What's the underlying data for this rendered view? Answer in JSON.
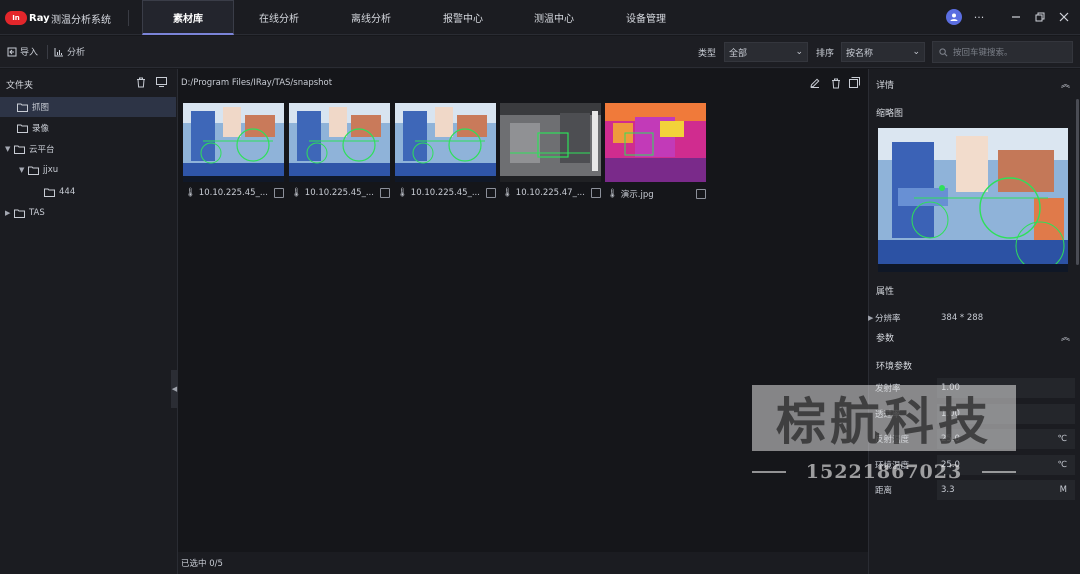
{
  "app": {
    "logo_text": "InfiRay",
    "title": "测温分析系统",
    "nav_tabs": [
      {
        "label": "素材库",
        "active": true
      },
      {
        "label": "在线分析",
        "active": false
      },
      {
        "label": "离线分析",
        "active": false
      },
      {
        "label": "报警中心",
        "active": false
      },
      {
        "label": "测温中心",
        "active": false
      },
      {
        "label": "设备管理",
        "active": false
      }
    ],
    "accent": "#7b84d8",
    "brand_red": "#e3262b"
  },
  "toolbar": {
    "import_label": "导入",
    "analyze_label": "分析",
    "type_label": "类型",
    "type_value": "全部",
    "sort_label": "排序",
    "sort_value": "按名称",
    "search_placeholder": "按回车键搜索。"
  },
  "folders": {
    "header": "文件夹",
    "items": [
      {
        "label": "抓图",
        "selected": true
      },
      {
        "label": "录像",
        "selected": false
      },
      {
        "label": "云平台",
        "expanded": true
      },
      {
        "label": "jjxu",
        "expanded": true
      },
      {
        "label": "444"
      },
      {
        "label": "TAS",
        "expanded": false
      }
    ]
  },
  "content": {
    "path": "D:/Program Files/IRay/TAS/snapshot",
    "files": [
      {
        "name": "10.10.225.45_...",
        "palette": "ironbow-blue"
      },
      {
        "name": "10.10.225.45_...",
        "palette": "ironbow-blue"
      },
      {
        "name": "10.10.225.45_...",
        "palette": "ironbow-blue"
      },
      {
        "name": "10.10.225.47_...",
        "palette": "grayscale"
      },
      {
        "name": "演示.jpg",
        "palette": "ironbow-red"
      }
    ],
    "status": "已选中 0/5"
  },
  "details": {
    "header": "详情",
    "thumbnail_label": "缩略图",
    "attributes_label": "属性",
    "resolution_key": "分辨率",
    "resolution_value": "384 * 288",
    "params_label": "参数",
    "env_label": "环境参数",
    "env_params": [
      {
        "key": "发射率",
        "value": "1.00",
        "unit": ""
      },
      {
        "key": "透过率",
        "value": "1.00",
        "unit": ""
      },
      {
        "key": "反射温度",
        "value": "25.0",
        "unit": "℃"
      },
      {
        "key": "环境温度",
        "value": "25.0",
        "unit": "℃"
      },
      {
        "key": "距离",
        "value": "3.3",
        "unit": "M"
      }
    ]
  },
  "watermark": {
    "text": "棕航科技",
    "phone": "15221867023"
  }
}
